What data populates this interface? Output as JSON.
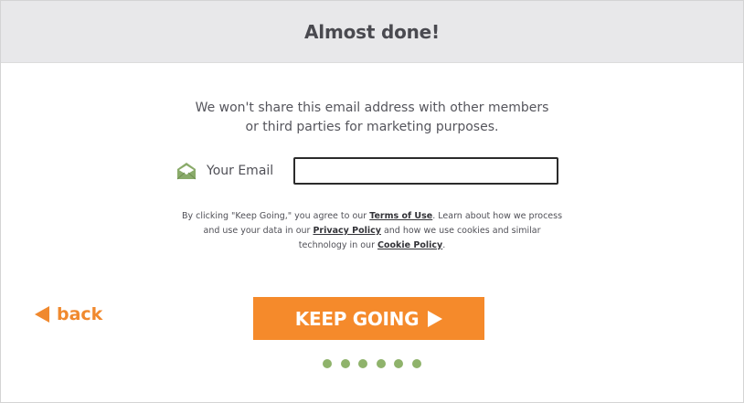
{
  "header": {
    "title": "Almost done!"
  },
  "privacy": {
    "line1": "We won't share this email address with other members",
    "line2": "or third parties for marketing purposes."
  },
  "email": {
    "icon": "envelope-icon",
    "label": "Your Email",
    "value": "",
    "placeholder": ""
  },
  "legal": {
    "part1": "By clicking \"Keep Going,\" you agree to our ",
    "terms_link": "Terms of Use",
    "part2": ". Learn about how we process",
    "part3": "and use your data in our ",
    "privacy_link": "Privacy Policy",
    "part4": " and how we use cookies and similar",
    "part5": "technology in our ",
    "cookie_link": "Cookie Policy",
    "part6": "."
  },
  "nav": {
    "back_label": "back",
    "keep_going_label": "KEEP GOING"
  },
  "progress": {
    "dot_count": 6
  },
  "colors": {
    "accent_orange": "#f58a2b",
    "dot_green": "#8fb36b",
    "header_bg": "#e8e8ea",
    "icon_green": "#8aab6a"
  }
}
